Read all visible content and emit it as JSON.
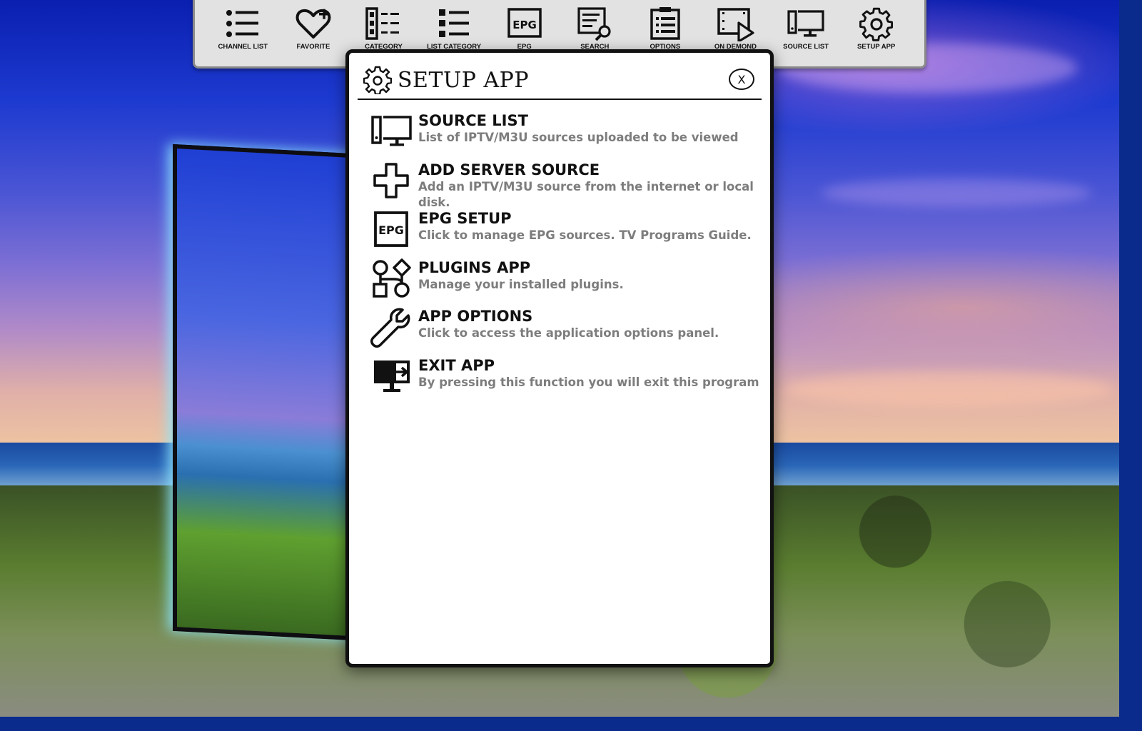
{
  "toolbar": {
    "items": [
      {
        "label": "CHANNEL LIST",
        "icon": "list-icon"
      },
      {
        "label": "FAVORITE",
        "icon": "heart-plus-icon"
      },
      {
        "label": "CATEGORY",
        "icon": "category-icon"
      },
      {
        "label": "LIST CATEGORY",
        "icon": "list-category-icon"
      },
      {
        "label": "EPG",
        "icon": "epg-icon"
      },
      {
        "label": "SEARCH",
        "icon": "search-icon"
      },
      {
        "label": "OPTIONS",
        "icon": "clipboard-icon"
      },
      {
        "label": "ON DEMOND",
        "icon": "film-play-icon"
      },
      {
        "label": "SOURCE LIST",
        "icon": "monitor-icon"
      },
      {
        "label": "SETUP APP",
        "icon": "gear-icon"
      }
    ]
  },
  "dialog": {
    "title": "SETUP APP",
    "close_label": "X",
    "items": [
      {
        "title": "SOURCE LIST",
        "description": "List of IPTV/M3U sources uploaded to be viewed",
        "icon": "monitor-icon"
      },
      {
        "title": "ADD SERVER SOURCE",
        "description": "Add an IPTV/M3U source from the internet or local disk.",
        "icon": "plus-icon"
      },
      {
        "title": "EPG SETUP",
        "description": "Click to manage EPG sources. TV Programs Guide.",
        "icon": "epg-icon"
      },
      {
        "title": "PLUGINS APP",
        "description": "Manage your installed plugins.",
        "icon": "shapes-icon"
      },
      {
        "title": "APP OPTIONS",
        "description": "Click to access the application options panel.",
        "icon": "wrench-icon"
      },
      {
        "title": "EXIT APP",
        "description": "By pressing this function you will exit this program",
        "icon": "exit-monitor-icon"
      }
    ]
  },
  "colors": {
    "toolbar_bg": "#e2e2e2",
    "dialog_bg": "#ffffff",
    "title_color": "#111111",
    "description_color": "#7d7d7d"
  }
}
